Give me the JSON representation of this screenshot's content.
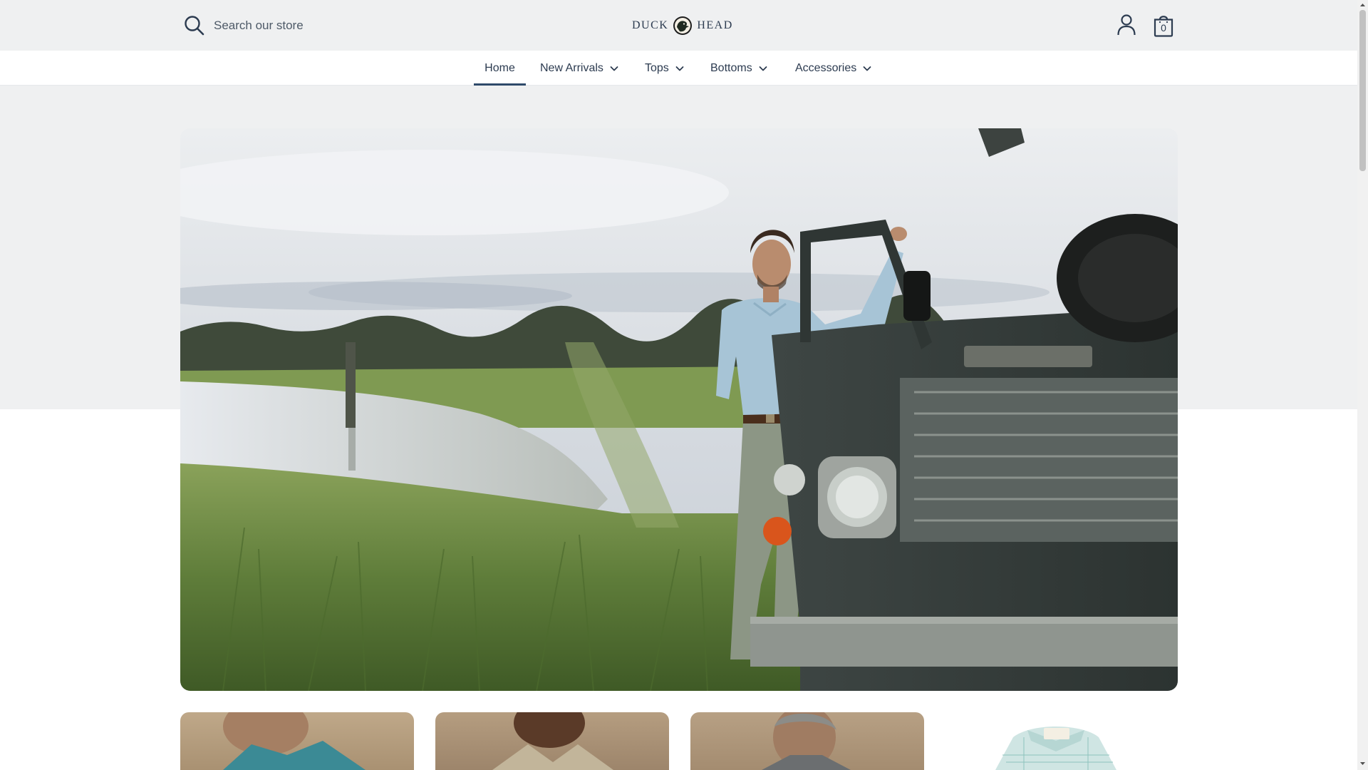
{
  "search": {
    "placeholder": "Search our store",
    "value": "",
    "icon": "search-icon"
  },
  "brand": {
    "left": "DUCK",
    "right": "HEAD",
    "mark_icon": "duck-head-logo"
  },
  "header": {
    "account_icon": "user-icon",
    "cart_icon": "shopping-bag-icon",
    "cart_count": "0"
  },
  "nav": {
    "items": [
      {
        "label": "Home",
        "active": true,
        "has_dropdown": false
      },
      {
        "label": "New Arrivals",
        "active": false,
        "has_dropdown": true
      },
      {
        "label": "Tops",
        "active": false,
        "has_dropdown": true
      },
      {
        "label": "Bottoms",
        "active": false,
        "has_dropdown": true
      },
      {
        "label": "Accessories",
        "active": false,
        "has_dropdown": true
      }
    ]
  },
  "colors": {
    "header_bg": "#eff0f1",
    "text": "#2c3b50",
    "nav_active_underline": "#2f4a6a",
    "band_bg": "#eff0f1"
  }
}
